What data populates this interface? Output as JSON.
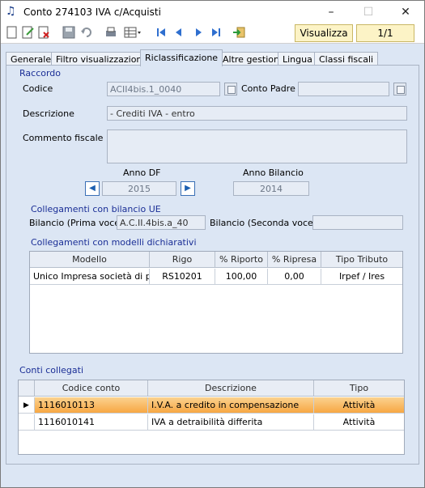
{
  "window": {
    "title": "Conto 274103 IVA c/Acquisti",
    "icon": "music-note-icon",
    "minimize": "–",
    "maximize": "☐",
    "close": "✕"
  },
  "toolbar": {
    "view_label": "Visualizza",
    "page_label": "1/1"
  },
  "tabs": [
    {
      "label": "Generale"
    },
    {
      "label": "Filtro visualizzazione"
    },
    {
      "label": "Riclassificazione"
    },
    {
      "label": "Altre gestioni"
    },
    {
      "label": "Lingua"
    },
    {
      "label": "Classi fiscali"
    }
  ],
  "raccordo": {
    "section_label": "Raccordo",
    "codice_label": "Codice",
    "codice_value": "ACII4bis.1_0040",
    "conto_padre_label": "Conto Padre",
    "conto_padre_value": "",
    "descrizione_label": "Descrizione",
    "descrizione_value": "- Crediti IVA - entro",
    "commento_label": "Commento fiscale",
    "commento_value": "",
    "anno_df_label": "Anno DF",
    "anno_df_value": "2015",
    "anno_bilancio_label": "Anno Bilancio",
    "anno_bilancio_value": "2014"
  },
  "bilancio_ue": {
    "section_label": "Collegamenti con bilancio UE",
    "prima_label": "Bilancio (Prima voce)",
    "prima_value": "A.C.II.4bis.a_40",
    "seconda_label": "Bilancio (Seconda voce)",
    "seconda_value": ""
  },
  "modelli": {
    "section_label": "Collegamenti con modelli dichiarativi",
    "columns": [
      "Modello",
      "Rigo",
      "% Riporto",
      "% Ripresa",
      "Tipo Tributo"
    ],
    "rows": [
      [
        "Unico Impresa società di p...",
        "RS10201",
        "100,00",
        "0,00",
        "Irpef / Ires"
      ]
    ]
  },
  "conti": {
    "section_label": "Conti collegati",
    "columns": [
      "Codice conto",
      "Descrizione",
      "Tipo"
    ],
    "rows": [
      [
        "1116010113",
        "I.V.A. a credito in compensazione",
        "Attività"
      ],
      [
        "1116010141",
        "IVA a detraibilità differita",
        "Attività"
      ]
    ],
    "selected_row": 0
  },
  "colors": {
    "accent_blue": "#1a2e96",
    "panel_bg": "#dce6f4",
    "highlight": "#f7a743"
  }
}
